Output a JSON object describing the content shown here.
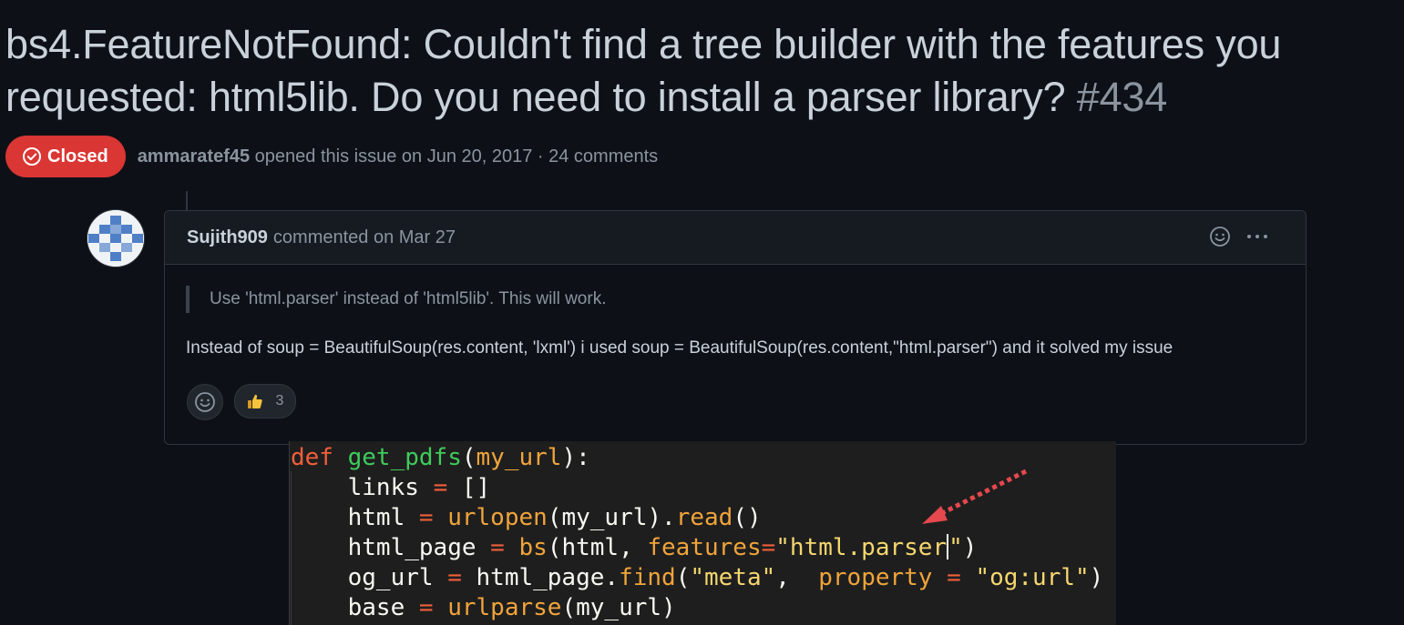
{
  "issue": {
    "title": "bs4.FeatureNotFound: Couldn't find a tree builder with the features you requested: html5lib. Do you need to install a parser library?",
    "number": "#434",
    "status": "Closed",
    "author": "ammaratef45",
    "opened_text": "opened this issue on Jun 20, 2017 · 24 comments"
  },
  "comment": {
    "author": "Sujith909",
    "meta": "commented on Mar 27",
    "quote": "Use 'html.parser' instead of 'html5lib'. This will work.",
    "body": "Instead of soup = BeautifulSoup(res.content, 'lxml') i used soup = BeautifulSoup(res.content,\"html.parser\") and it solved my issue",
    "reactions": {
      "thumbs_up_count": "3"
    }
  },
  "code": {
    "line1": {
      "kw": "def",
      "fn": "get_pdfs",
      "open": "(",
      "param": "my_url",
      "close": "):"
    },
    "line2": {
      "var": "links",
      "op": "=",
      "val": "[]"
    },
    "line3": {
      "var": "html",
      "op": "=",
      "call": "urlopen",
      "arg": "(my_url).",
      "call2": "read",
      "end": "()"
    },
    "line4": {
      "var": "html_page",
      "op": "=",
      "call": "bs",
      "arg": "(html, ",
      "kwarg": "features",
      "eq": "=",
      "str_a": "\"html.parser",
      "str_b": "\"",
      "end": ")"
    },
    "line5": {
      "var": "og_url",
      "op": "=",
      "obj": "html_page.",
      "call": "find",
      "open": "(",
      "str1": "\"meta\"",
      "sep": ",  ",
      "kwarg": "property",
      "eq": "=",
      "str2": "\"og:url\"",
      "end": ")"
    },
    "line6": {
      "var": "base",
      "op": "=",
      "call": "urlparse",
      "end": "(my_url)"
    }
  },
  "colors": {
    "closed_badge": "#da3633",
    "background": "#0d1117",
    "code_background": "#1e1e1e",
    "arrow": "#e5484d"
  },
  "icons": [
    "check-circle-icon",
    "smiley-icon",
    "kebab-menu-icon",
    "thumbs-up-icon",
    "red-arrow-annotation"
  ]
}
